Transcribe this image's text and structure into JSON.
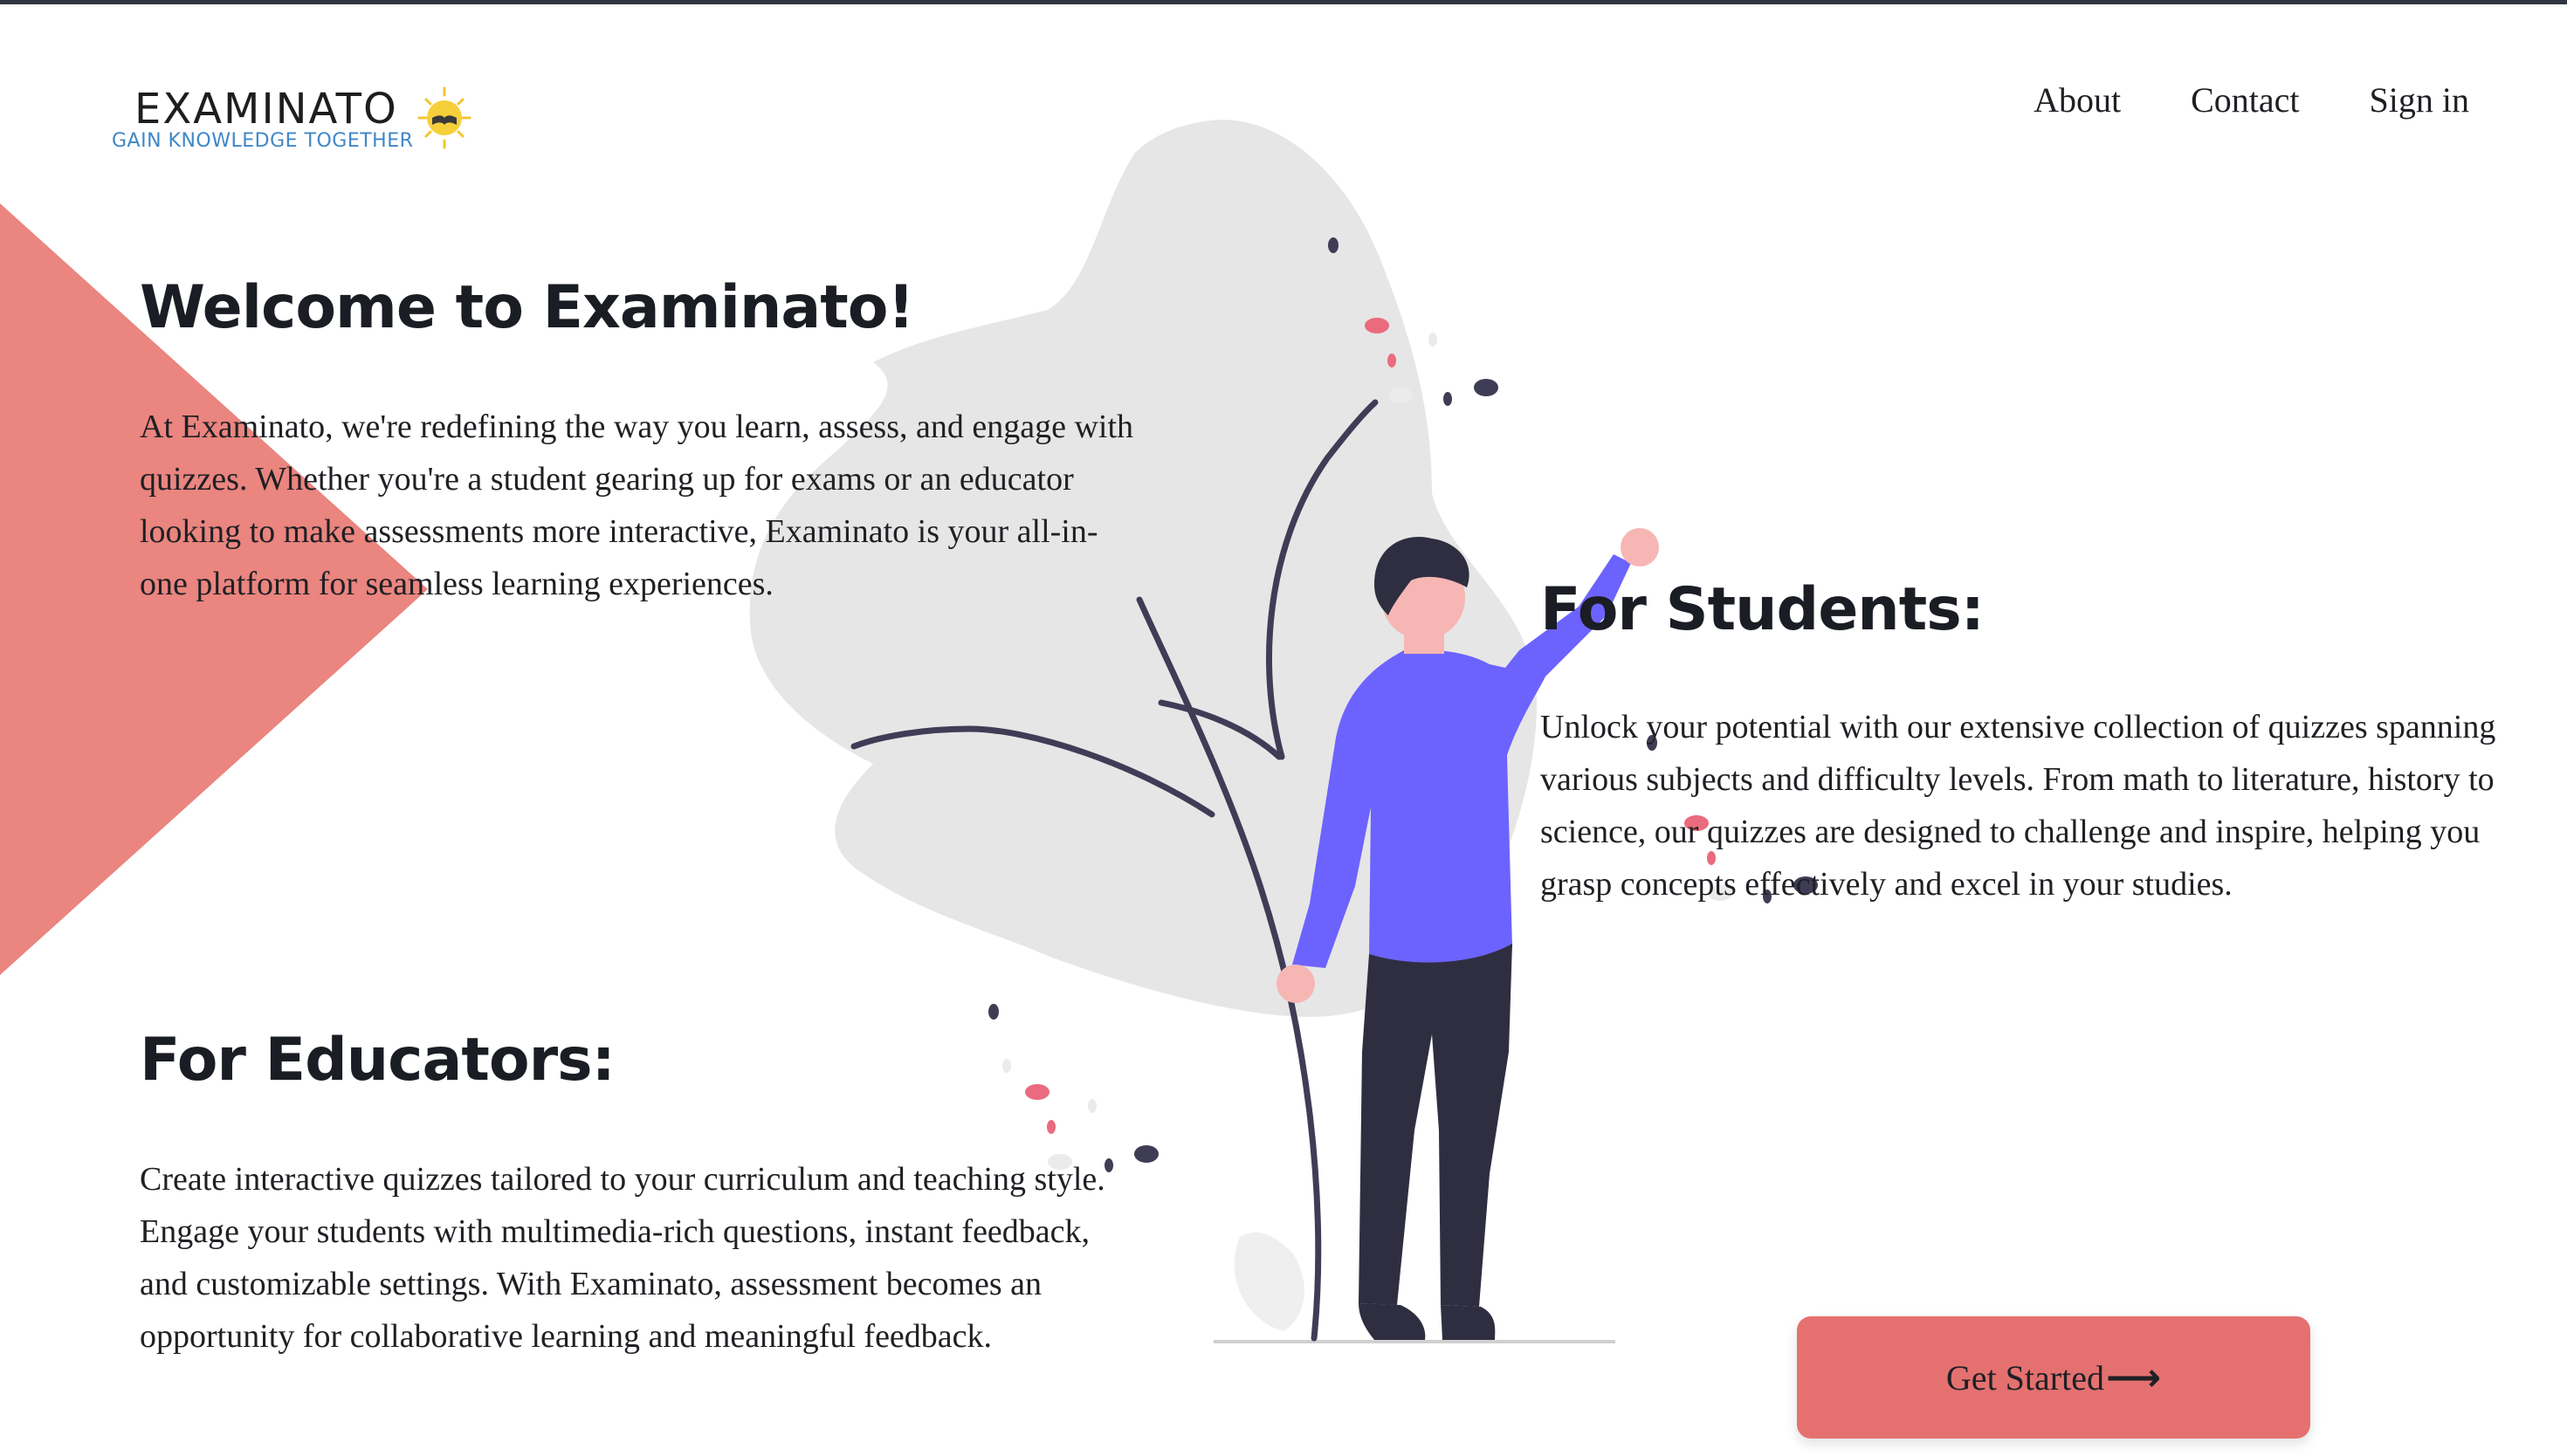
{
  "brand": {
    "name": "EXAMINATO",
    "tagline": "GAIN KNOWLEDGE TOGETHER"
  },
  "nav": {
    "items": [
      {
        "label": "About"
      },
      {
        "label": "Contact"
      },
      {
        "label": "Sign in"
      }
    ]
  },
  "welcome": {
    "title": "Welcome to Examinato!",
    "text": "At Examinato, we're redefining the way you learn, assess, and engage with quizzes. Whether you're a student gearing up for exams or an educator looking to make assessments more interactive, Examinato is your all-in-one platform for seamless learning experiences."
  },
  "students": {
    "title": "For Students:",
    "text": "Unlock your potential with our extensive collection of quizzes spanning various subjects and difficulty levels. From math to literature, history to science, our quizzes are designed to challenge and inspire, helping you grasp concepts effectively and excel in your studies."
  },
  "educators": {
    "title": "For Educators:",
    "text": "Create interactive quizzes tailored to your curriculum and teaching style. Engage your students with multimedia-rich questions, instant feedback, and customizable settings. With Examinato, assessment becomes an opportunity for collaborative learning and meaningful feedback."
  },
  "cta": {
    "label": "Get Started",
    "arrow_icon": "arrow-right-icon"
  },
  "colors": {
    "accent": "#e47170",
    "triangle": "#ea857f",
    "figure_shirt": "#6c63ff",
    "figure_pants": "#2f2e41",
    "blob": "#e6e6e6",
    "tagline": "#3f87c8",
    "text": "#1f2024"
  },
  "icons": {
    "logo": "sun-book-icon",
    "illustration": "person-reaching-with-plant-illustration"
  }
}
